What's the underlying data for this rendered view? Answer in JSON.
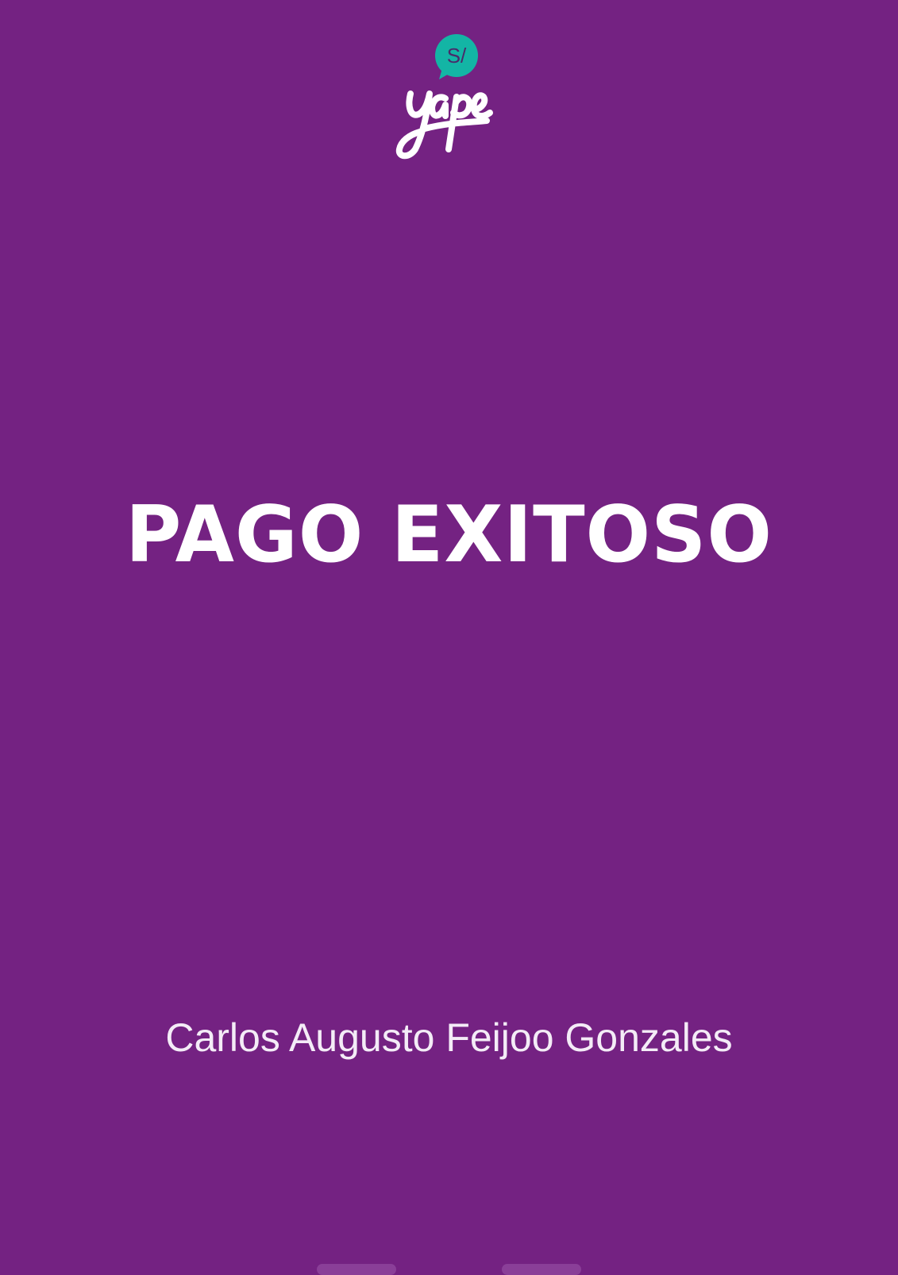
{
  "app": {
    "logo_text": "yape",
    "logo_badge": "S/",
    "brand_color": "#742282",
    "badge_color": "#13b5a5"
  },
  "main": {
    "title": "PAGO EXITOSO",
    "recipient_name": "Carlos Augusto Feijoo Gonzales"
  }
}
